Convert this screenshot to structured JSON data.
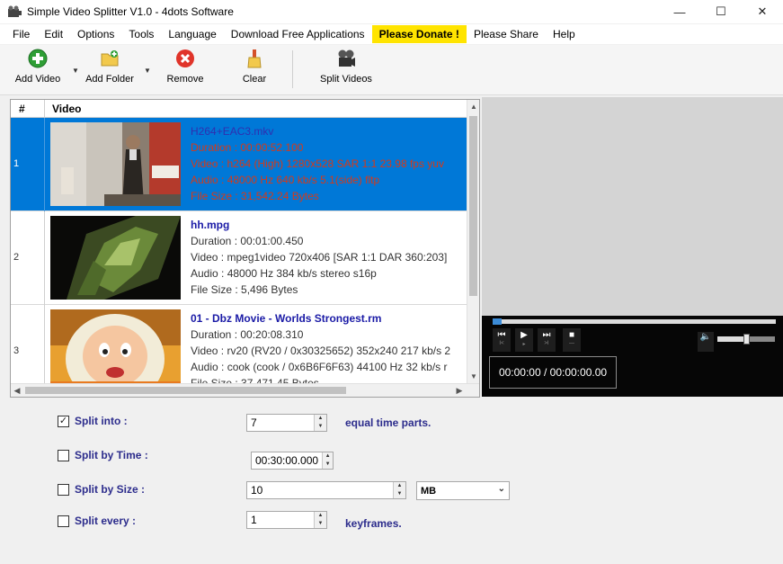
{
  "window": {
    "title": "Simple Video Splitter V1.0 - 4dots Software"
  },
  "menu": {
    "items": [
      {
        "label": "File"
      },
      {
        "label": "Edit"
      },
      {
        "label": "Options"
      },
      {
        "label": "Tools"
      },
      {
        "label": "Language"
      },
      {
        "label": "Download Free Applications"
      },
      {
        "label": "Please Donate !"
      },
      {
        "label": "Please Share"
      },
      {
        "label": "Help"
      }
    ]
  },
  "toolbar": {
    "add_video": "Add Video",
    "add_folder": "Add Folder",
    "remove": "Remove",
    "clear": "Clear",
    "split_videos": "Split Videos"
  },
  "list": {
    "col_num": "#",
    "col_video": "Video",
    "rows": [
      {
        "num": "1",
        "filename": "H264+EAC3.mkv",
        "duration": "Duration : 00:00:52.100",
        "video": "Video : h264 (High) 1280x528 SAR 1:1 23.98 fps yuv",
        "audio": "Audio : 48000 Hz 640 kb/s 5.1(side) fltp",
        "size": "File Size : 31,542.24 Bytes"
      },
      {
        "num": "2",
        "filename": "hh.mpg",
        "duration": "Duration : 00:01:00.450",
        "video": "Video : mpeg1video 720x406 [SAR 1:1 DAR 360:203]",
        "audio": "Audio : 48000 Hz 384 kb/s stereo s16p",
        "size": "File Size : 5,496 Bytes"
      },
      {
        "num": "3",
        "filename": "01 - Dbz Movie - Worlds Strongest.rm",
        "duration": "Duration : 00:20:08.310",
        "video": "Video : rv20 (RV20 / 0x30325652) 352x240 217 kb/s 2",
        "audio": "Audio : cook (cook / 0x6B6F6F63) 44100 Hz 32 kb/s r",
        "size": "File Size : 37,471.45 Bytes"
      }
    ]
  },
  "player": {
    "time": "00:00:00 / 00:00:00.00",
    "volume": 0.5
  },
  "options": {
    "split_into": {
      "label": "Split into :",
      "checked": "✓",
      "value": "7",
      "suffix": "equal time parts."
    },
    "split_by_time": {
      "label": "Split by Time :",
      "checked": "",
      "value": "00:30:00.000"
    },
    "split_by_size": {
      "label": "Split by Size :",
      "checked": "",
      "value": "10",
      "unit": "MB"
    },
    "split_every": {
      "label": "Split every :",
      "checked": "",
      "value": "1",
      "suffix": "keyframes."
    }
  },
  "colors": {
    "selection": "#0078d7",
    "donate": "#ffe400",
    "label": "#2c2c8c"
  }
}
